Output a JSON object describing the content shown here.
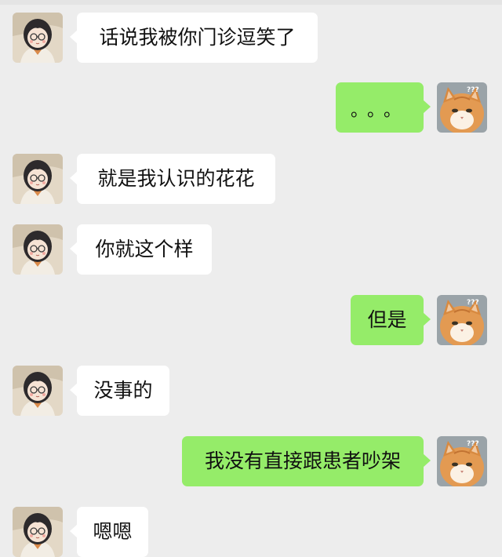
{
  "colors": {
    "background": "#ededed",
    "incoming_bubble": "#ffffff",
    "outgoing_bubble": "#95ec69",
    "text": "#111111"
  },
  "avatars": {
    "contact": "girl-cartoon-avatar",
    "self": "orange-cat-confused-avatar"
  },
  "messages": [
    {
      "side": "incoming",
      "text": "话说我被你门诊逗笑了"
    },
    {
      "side": "outgoing",
      "text": "。。。"
    },
    {
      "side": "incoming",
      "text": "就是我认识的花花"
    },
    {
      "side": "incoming",
      "text": "你就这个样"
    },
    {
      "side": "outgoing",
      "text": "但是"
    },
    {
      "side": "incoming",
      "text": "没事的"
    },
    {
      "side": "outgoing",
      "text": "我没有直接跟患者吵架"
    },
    {
      "side": "incoming",
      "text": "嗯嗯"
    }
  ]
}
